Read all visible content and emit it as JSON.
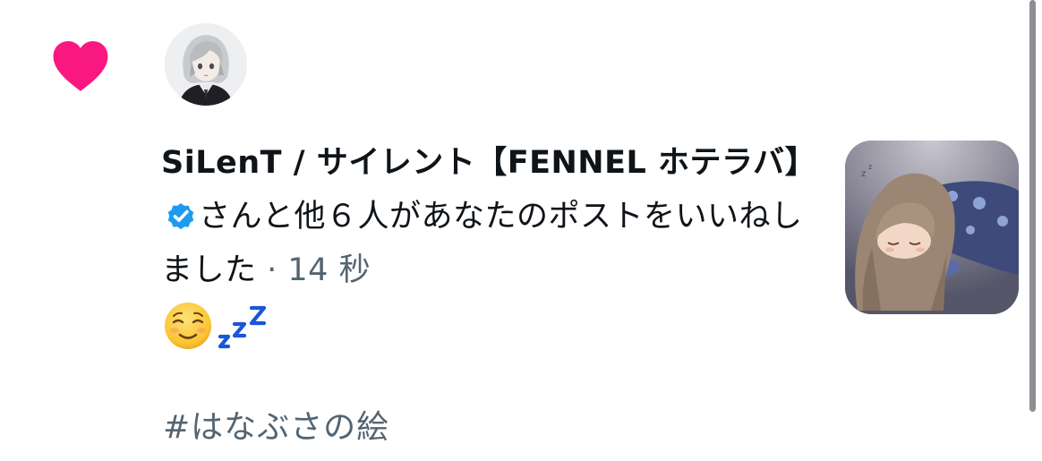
{
  "notification": {
    "type_icon": "heart-icon",
    "avatar_icon": "avatar-anime-character",
    "user_name": "SiLenT / サイレント【FENNEL ホテラバ】",
    "verified_icon": "verified-badge-icon",
    "action_text": "さんと他６人があなたのポストをいいねしました",
    "separator": " · ",
    "timestamp": "14 秒",
    "emoji": [
      "relieved-face-emoji",
      "zzz-emoji"
    ],
    "post_text": "#はなぶさの絵",
    "thumbnail": "sleeping-girl-illustration"
  },
  "colors": {
    "heart": "#f91880",
    "verified": "#1d9bf0",
    "zzz": "#1a56db",
    "secondary_text": "#536471",
    "primary_text": "#0f1419"
  }
}
